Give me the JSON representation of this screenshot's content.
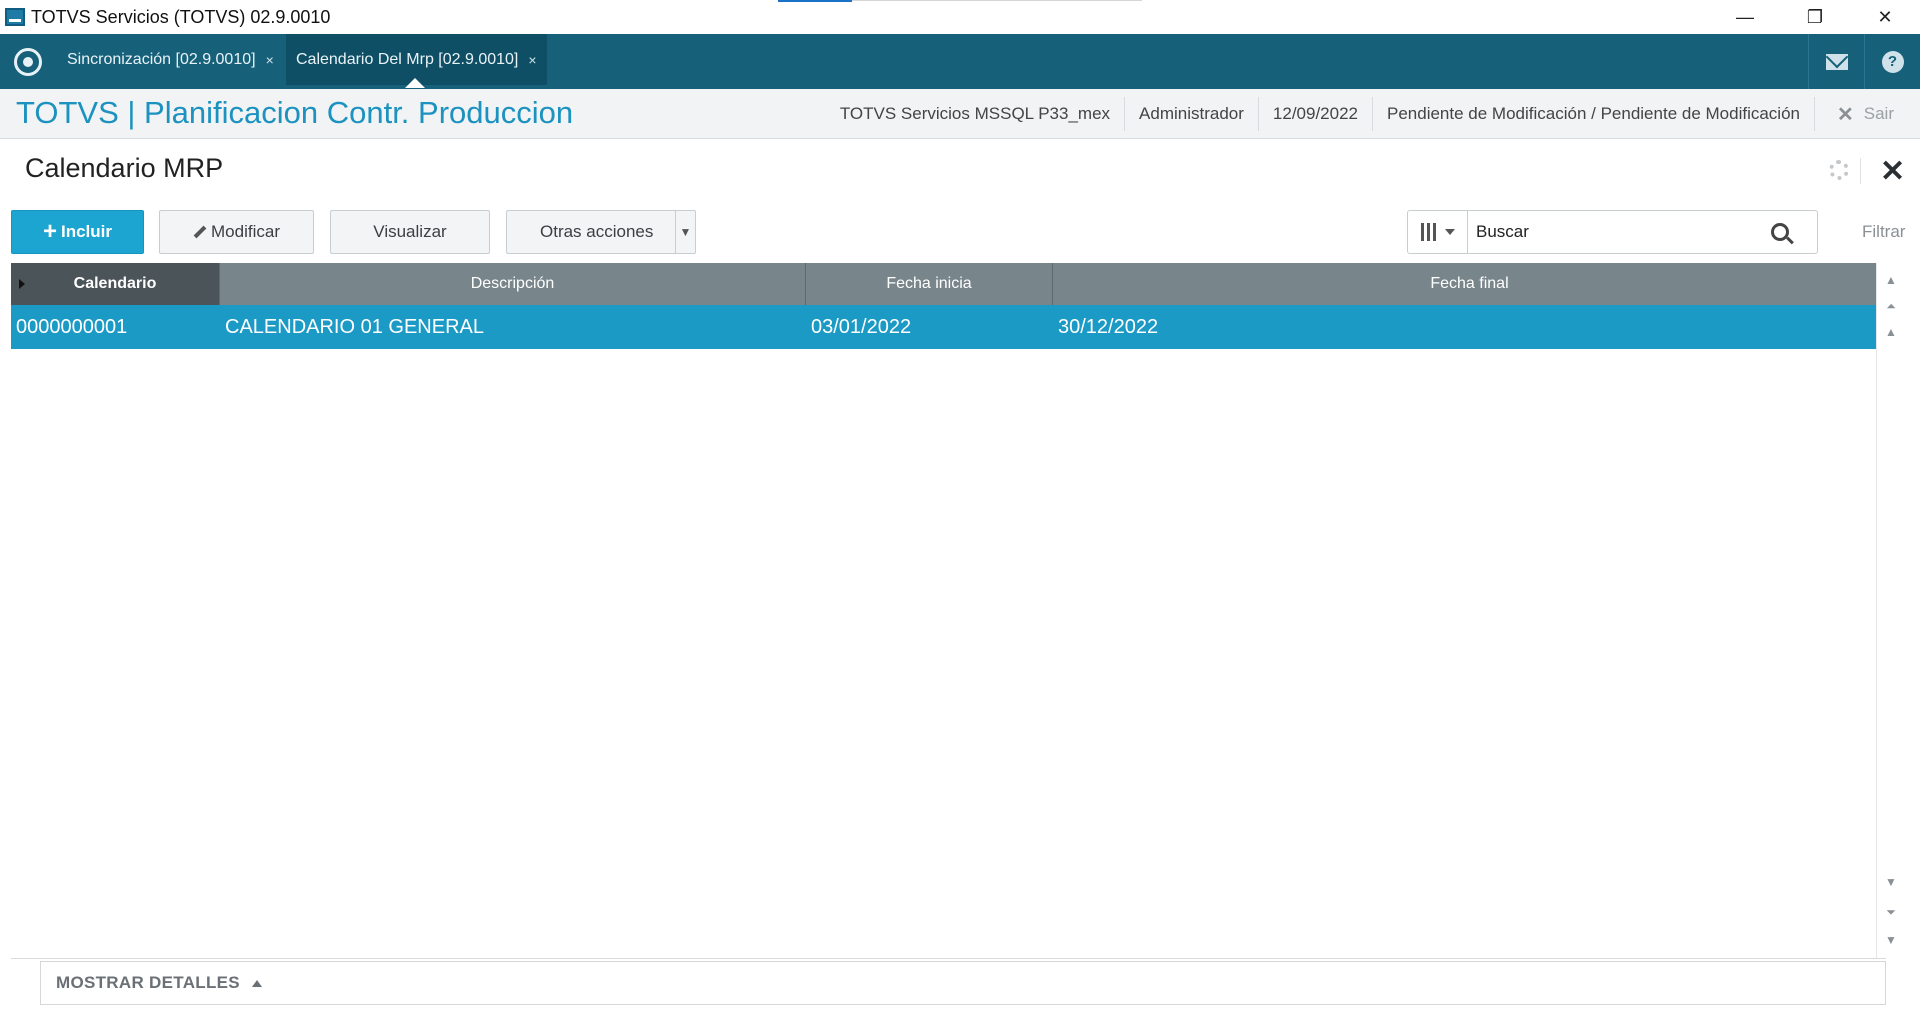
{
  "window": {
    "title": "TOTVS Servicios (TOTVS) 02.9.0010",
    "controls": {
      "minimize": "—",
      "restore": "❐",
      "close": "✕"
    }
  },
  "tabs": [
    {
      "label": "Sincronización [02.9.0010]",
      "close": "×",
      "active": false
    },
    {
      "label": "Calendario Del Mrp [02.9.0010]",
      "close": "×",
      "active": true
    }
  ],
  "header": {
    "title": "TOTVS | Planificacion Contr. Produccion",
    "environment": "TOTVS Servicios MSSQL P33_mex",
    "user": "Administrador",
    "date": "12/09/2022",
    "status": "Pendiente de Modificación / Pendiente de Modificación",
    "exit_label": "Sair"
  },
  "page": {
    "title": "Calendario MRP"
  },
  "toolbar": {
    "include_label": "Incluir",
    "modify_label": "Modificar",
    "view_label": "Visualizar",
    "other_actions_label": "Otras acciones",
    "search_value": "Buscar",
    "filter_label": "Filtrar"
  },
  "grid": {
    "columns": [
      "Calendario",
      "Descripción",
      "Fecha inicia",
      "Fecha final"
    ],
    "rows": [
      [
        "0000000001",
        "CALENDARIO 01 GENERAL",
        "03/01/2022",
        "30/12/2022"
      ]
    ]
  },
  "details": {
    "label": "MOSTRAR DETALLES"
  },
  "colors": {
    "tabbar": "#16607a",
    "accent": "#1b92bf",
    "selected_row": "#1b9ac6",
    "primary_button": "#1ba5d0"
  }
}
